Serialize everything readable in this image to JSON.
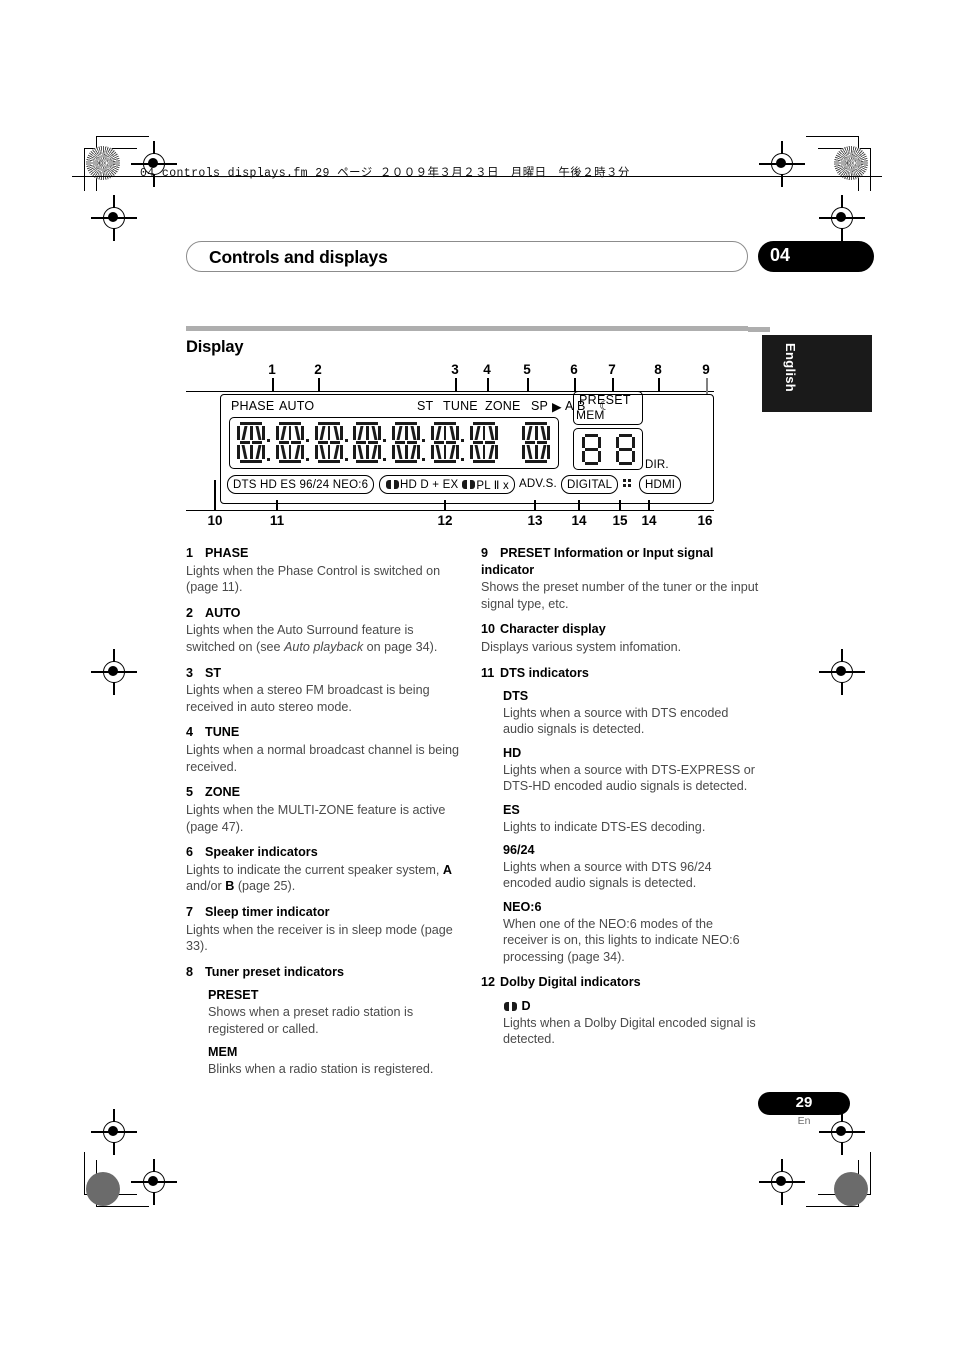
{
  "header": {
    "file_line": "04_controls_displays.fm  29 ページ  ２００９年３月２３日　月曜日　午後２時３分",
    "title": "Controls and displays",
    "chapter": "04",
    "language_tab": "English"
  },
  "section": {
    "heading": "Display"
  },
  "diagram": {
    "callouts_top": [
      "1",
      "2",
      "3",
      "4",
      "5",
      "6",
      "7",
      "8",
      "9"
    ],
    "callouts_bottom": [
      "10",
      "11",
      "12",
      "13",
      "14",
      "15",
      "14",
      "16"
    ],
    "top_labels": [
      "PHASE",
      "AUTO",
      "ST",
      "TUNE",
      "ZONE",
      "SP",
      "A",
      "B"
    ],
    "sleep_icon": "crescent-moon-icon",
    "preset_label": "PRESET",
    "mem_label": "MEM",
    "dir_label": "DIR.",
    "dts_group": "DTS HD ES 96/24 NEO:6",
    "dolby_group_pre": "HD D + EX",
    "dolby_group_post": "PL Ⅱ x",
    "adv_s": "ADV.S.",
    "digital": "DIGITAL",
    "hdmi": "HDMI"
  },
  "items_left": [
    {
      "num": "1",
      "title": "PHASE",
      "body": "Lights when the Phase Control is switched on (page 11)."
    },
    {
      "num": "2",
      "title": "AUTO",
      "body_pre": "Lights when the Auto Surround feature is switched on (see ",
      "body_em": "Auto playback",
      "body_post": " on page 34)."
    },
    {
      "num": "3",
      "title": "ST",
      "body": "Lights when a stereo FM broadcast is being received in auto stereo mode."
    },
    {
      "num": "4",
      "title": "TUNE",
      "body": "Lights when a normal broadcast channel is being received."
    },
    {
      "num": "5",
      "title": "ZONE",
      "body": "Lights when the MULTI-ZONE feature is active (page 47)."
    },
    {
      "num": "6",
      "title": "Speaker indicators",
      "body_pre": "Lights to indicate the current speaker system, ",
      "body_b1": "A",
      "body_mid": " and/or ",
      "body_b2": "B",
      "body_post": " (page 25)."
    },
    {
      "num": "7",
      "title": "Sleep timer indicator",
      "body": "Lights when the receiver is in sleep mode (page 33)."
    },
    {
      "num": "8",
      "title": "Tuner preset indicators",
      "subs": [
        {
          "title": "PRESET",
          "body": "Shows when a preset radio station is registered or called."
        },
        {
          "title": "MEM",
          "body": "Blinks when a radio station is registered."
        }
      ]
    }
  ],
  "items_right": [
    {
      "num": "9",
      "title": "PRESET Information or Input signal indicator",
      "body": "Shows the preset number of the tuner or the input signal type, etc."
    },
    {
      "num": "10",
      "title": "Character display",
      "body": "Displays various system infomation."
    },
    {
      "num": "11",
      "title": "DTS indicators",
      "subs": [
        {
          "title": "DTS",
          "body": "Lights when a source with DTS encoded audio signals is detected."
        },
        {
          "title": "HD",
          "body": "Lights when a source with DTS-EXPRESS or DTS-HD encoded audio signals is detected."
        },
        {
          "title": "ES",
          "body": "Lights to indicate DTS-ES decoding."
        },
        {
          "title": "96/24",
          "body": "Lights when a source with DTS 96/24 encoded audio signals is detected."
        },
        {
          "title": "NEO:6",
          "body": "When one of the NEO:6 modes of the receiver is on, this lights to indicate NEO:6 processing (page 34)."
        }
      ]
    },
    {
      "num": "12",
      "title": "Dolby Digital indicators",
      "subs": [
        {
          "title": "D",
          "title_icon": "dolby-double-d-icon",
          "body": "Lights when a Dolby Digital encoded signal is detected."
        }
      ]
    }
  ],
  "footer": {
    "page": "29",
    "lang": "En"
  }
}
